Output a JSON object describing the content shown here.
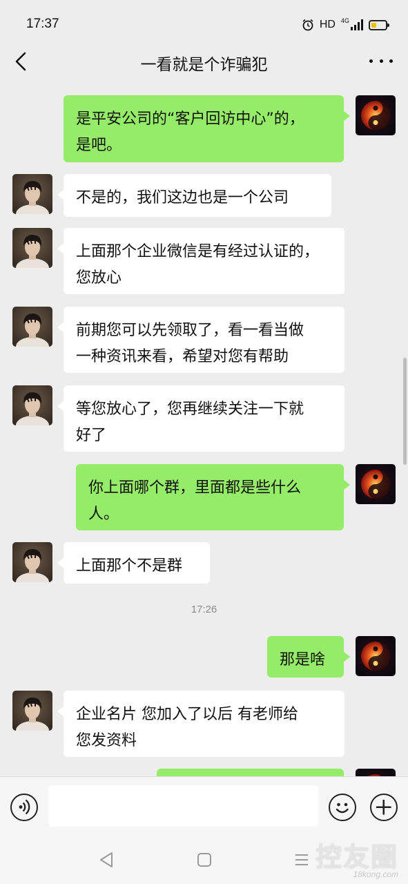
{
  "status_bar": {
    "time": "17:37",
    "hd": "HD",
    "network": "4G",
    "battery_level": 0.35,
    "battery_color": "#f2c200"
  },
  "header": {
    "title": "一看就是个诈骗犯",
    "back_icon": "chevron-left-icon",
    "more_icon": "more-dots-icon"
  },
  "messages": [
    {
      "sender": "me",
      "text_lines": [
        "是平安公司的“客户回访中心”的，",
        "是吧。"
      ]
    },
    {
      "sender": "other",
      "text_lines": [
        "不是的，我们这边也是一个公司"
      ]
    },
    {
      "sender": "other",
      "text_lines": [
        "上面那个企业微信是有经过认证的，",
        "您放心"
      ]
    },
    {
      "sender": "other",
      "text_lines": [
        "前期您可以先领取了，看一看当做",
        "一种资讯来看，希望对您有帮助"
      ]
    },
    {
      "sender": "other",
      "text_lines": [
        "等您放心了，您再继续关注一下就",
        "好了"
      ]
    },
    {
      "sender": "me",
      "text_lines": [
        "你上面哪个群，里面都是些什么",
        "人。"
      ]
    },
    {
      "sender": "other",
      "text_lines": [
        "上面那个不是群"
      ]
    },
    {
      "sender": "me",
      "text_lines": [
        "那是啥"
      ]
    },
    {
      "sender": "other",
      "text_lines": [
        "企业名片 您加入了以后 有老师给",
        "您发资料"
      ]
    },
    {
      "sender": "me",
      "text_lines": [
        ""
      ]
    }
  ],
  "timestamp": "17:26",
  "input_bar": {
    "voice_icon": "voice-icon",
    "emoji_icon": "emoji-icon",
    "plus_icon": "plus-icon",
    "placeholder": ""
  },
  "system_nav": {
    "back_icon": "triangle-back-icon",
    "home_icon": "square-home-icon",
    "menu_icon": "menu-lines-icon"
  },
  "watermark": {
    "main": "控友圈",
    "sub": "18kong.com"
  },
  "colors": {
    "sent_bubble": "#95ec69",
    "received_bubble": "#ffffff",
    "background": "#ededed"
  }
}
